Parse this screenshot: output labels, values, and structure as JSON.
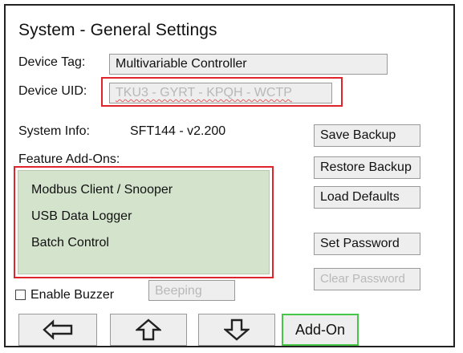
{
  "title": "System - General Settings",
  "device_tag": {
    "label": "Device Tag:",
    "value": "Multivariable Controller"
  },
  "device_uid": {
    "label": "Device UID:",
    "value": "TKU3 - GYRT - KPQH - WCTP"
  },
  "system_info": {
    "label": "System Info:",
    "value": "SFT144 - v2.200"
  },
  "feature_addons": {
    "label": "Feature Add-Ons:",
    "items": [
      "Modbus Client / Snooper",
      "USB Data Logger",
      "Batch Control"
    ]
  },
  "buttons": {
    "save_backup": "Save Backup",
    "restore_backup": "Restore Backup",
    "load_defaults": "Load Defaults",
    "set_password": "Set Password",
    "clear_password": "Clear Password"
  },
  "buzzer": {
    "label": "Enable Buzzer",
    "checked": false,
    "beeping_label": "Beeping"
  },
  "nav": {
    "left_icon": "arrow-left-icon",
    "up_icon": "arrow-up-icon",
    "down_icon": "arrow-down-icon",
    "addon_label": "Add-On"
  },
  "colors": {
    "highlight_border": "#e0242c",
    "addon_list_bg": "#d4e4cc",
    "addon_button_border": "#46c646",
    "button_bg": "#eeeeee",
    "disabled_text": "#b8b8b8"
  }
}
